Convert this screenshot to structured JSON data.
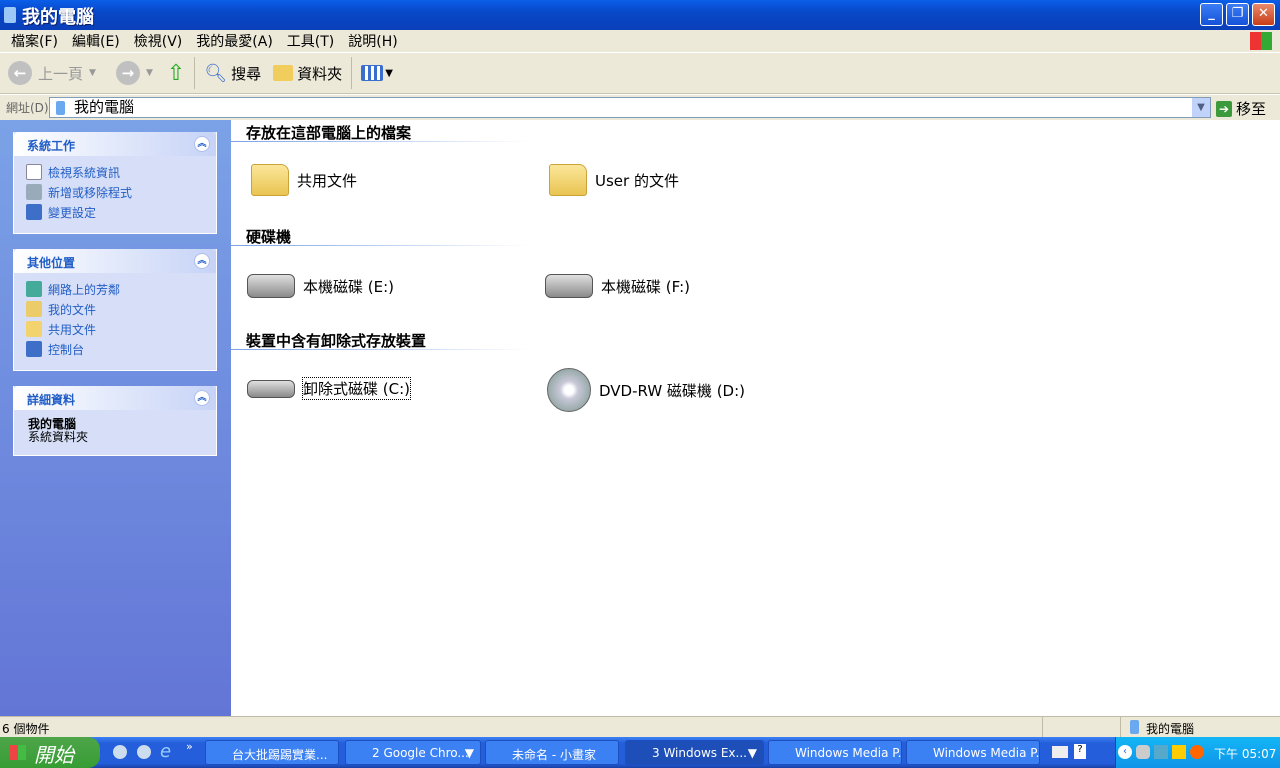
{
  "window": {
    "title": "我的電腦"
  },
  "menu": [
    "檔案(F)",
    "編輯(E)",
    "檢視(V)",
    "我的最愛(A)",
    "工具(T)",
    "說明(H)"
  ],
  "toolbar": {
    "back": "上一頁",
    "search": "搜尋",
    "folders": "資料夾"
  },
  "address": {
    "label": "網址(D)",
    "value": "我的電腦",
    "go": "移至"
  },
  "sidebar": [
    {
      "title": "系統工作",
      "items": [
        "檢視系統資訊",
        "新增或移除程式",
        "變更設定"
      ]
    },
    {
      "title": "其他位置",
      "items": [
        "網路上的芳鄰",
        "我的文件",
        "共用文件",
        "控制台"
      ]
    },
    {
      "title": "詳細資料",
      "name": "我的電腦",
      "desc": "系統資料夾"
    }
  ],
  "sections": [
    {
      "title": "存放在這部電腦上的檔案",
      "items": [
        "共用文件",
        "User 的文件"
      ]
    },
    {
      "title": "硬碟機",
      "items": [
        "本機磁碟 (E:)",
        "本機磁碟 (F:)"
      ]
    },
    {
      "title": "裝置中含有卸除式存放裝置",
      "items": [
        "卸除式磁碟 (C:)",
        "DVD-RW 磁碟機 (D:)"
      ]
    }
  ],
  "status": {
    "count": "6 個物件",
    "location": "我的電腦"
  },
  "taskbar": {
    "start": "開始",
    "buttons": [
      "台大批踢踢實業...",
      "2 Google Chro...",
      "未命名 - 小畫家",
      "3 Windows Ex...",
      "Windows Media P...",
      "Windows Media P..."
    ],
    "clock": "下午 05:07"
  }
}
